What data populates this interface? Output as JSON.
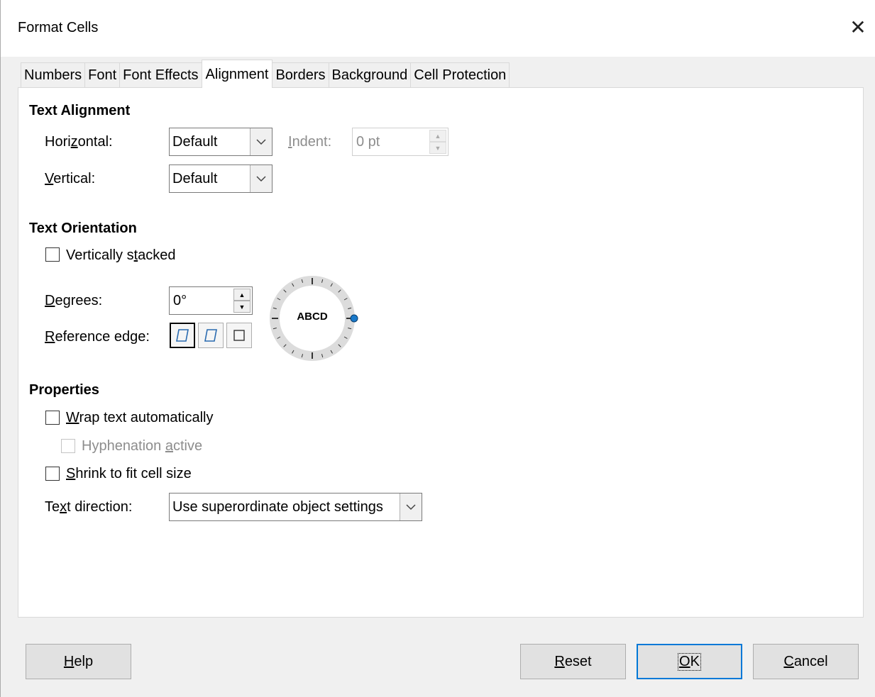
{
  "window": {
    "title": "Format Cells",
    "close_glyph": "✕"
  },
  "tabs": [
    {
      "label": "Numbers"
    },
    {
      "label": "Font"
    },
    {
      "label": "Font Effects"
    },
    {
      "label": "Alignment",
      "active": true
    },
    {
      "label": "Borders"
    },
    {
      "label": "Background"
    },
    {
      "label": "Cell Protection"
    }
  ],
  "text_alignment": {
    "heading": "Text Alignment",
    "horizontal": {
      "label_pre": "Hori",
      "label_key": "z",
      "label_post": "ontal:",
      "value": "Default"
    },
    "indent": {
      "label_pre": "",
      "label_key": "I",
      "label_post": "ndent:",
      "value": "0 pt",
      "enabled": false
    },
    "vertical": {
      "label_pre": "",
      "label_key": "V",
      "label_post": "ertical:",
      "value": "Default"
    }
  },
  "text_orientation": {
    "heading": "Text Orientation",
    "vertically_stacked": {
      "label_pre": "Vertically s",
      "label_key": "t",
      "label_post": "acked",
      "checked": false
    },
    "degrees": {
      "label_pre": "",
      "label_key": "D",
      "label_post": "egrees:",
      "value": "0°"
    },
    "reference_edge": {
      "label_pre": "",
      "label_key": "R",
      "label_post": "eference edge:"
    },
    "dial_text": "ABCD"
  },
  "properties": {
    "heading": "Properties",
    "wrap_text": {
      "label_pre": "",
      "label_key": "W",
      "label_post": "rap text automatically",
      "checked": false
    },
    "hyphenation": {
      "label_pre": "Hyphenation ",
      "label_key": "a",
      "label_post": "ctive",
      "checked": false,
      "enabled": false
    },
    "shrink": {
      "label_pre": "",
      "label_key": "S",
      "label_post": "hrink to fit cell size",
      "checked": false
    },
    "text_direction": {
      "label_pre": "Te",
      "label_key": "x",
      "label_post": "t direction:",
      "value": "Use superordinate object settings"
    }
  },
  "buttons": {
    "help": {
      "label_pre": "",
      "label_key": "H",
      "label_post": "elp"
    },
    "reset": {
      "label_pre": "",
      "label_key": "R",
      "label_post": "eset"
    },
    "ok": {
      "label_pre": "",
      "label_key": "O",
      "label_post": "K"
    },
    "cancel": {
      "label_pre": "",
      "label_key": "C",
      "label_post": "ancel"
    }
  },
  "colors": {
    "accent": "#0078d7",
    "dial_marker": "#1979ca"
  }
}
